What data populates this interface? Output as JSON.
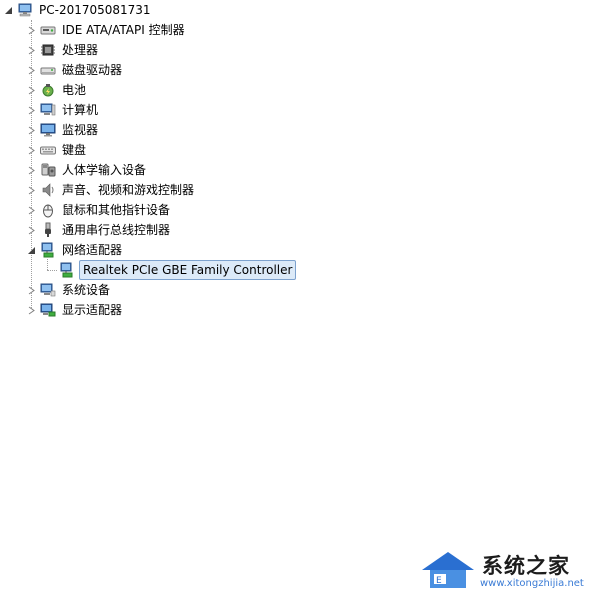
{
  "root": {
    "label": "PC-201705081731",
    "expanded": true
  },
  "categories": [
    {
      "label": "IDE ATA/ATAPI 控制器",
      "icon": "ide-controller-icon",
      "expanded": false
    },
    {
      "label": "处理器",
      "icon": "processor-icon",
      "expanded": false
    },
    {
      "label": "磁盘驱动器",
      "icon": "disk-drive-icon",
      "expanded": false
    },
    {
      "label": "电池",
      "icon": "battery-icon",
      "expanded": false
    },
    {
      "label": "计算机",
      "icon": "computer-icon",
      "expanded": false
    },
    {
      "label": "监视器",
      "icon": "monitor-icon",
      "expanded": false
    },
    {
      "label": "键盘",
      "icon": "keyboard-icon",
      "expanded": false
    },
    {
      "label": "人体学输入设备",
      "icon": "hid-icon",
      "expanded": false
    },
    {
      "label": "声音、视频和游戏控制器",
      "icon": "speaker-icon",
      "expanded": false
    },
    {
      "label": "鼠标和其他指针设备",
      "icon": "mouse-icon",
      "expanded": false
    },
    {
      "label": "通用串行总线控制器",
      "icon": "usb-icon",
      "expanded": false
    },
    {
      "label": "网络适配器",
      "icon": "network-adapter-icon",
      "expanded": true,
      "children": [
        {
          "label": "Realtek PCIe GBE Family Controller",
          "icon": "network-adapter-icon",
          "selected": true
        }
      ]
    },
    {
      "label": "系统设备",
      "icon": "system-device-icon",
      "expanded": false
    },
    {
      "label": "显示适配器",
      "icon": "display-adapter-icon",
      "expanded": false
    }
  ],
  "watermark": {
    "text": "系统之家",
    "url": "www.xitongzhijia.net"
  },
  "colors": {
    "selection_bg": "#dceaf8",
    "selection_border": "#7da2ce",
    "tree_line": "#a0a0a0"
  }
}
